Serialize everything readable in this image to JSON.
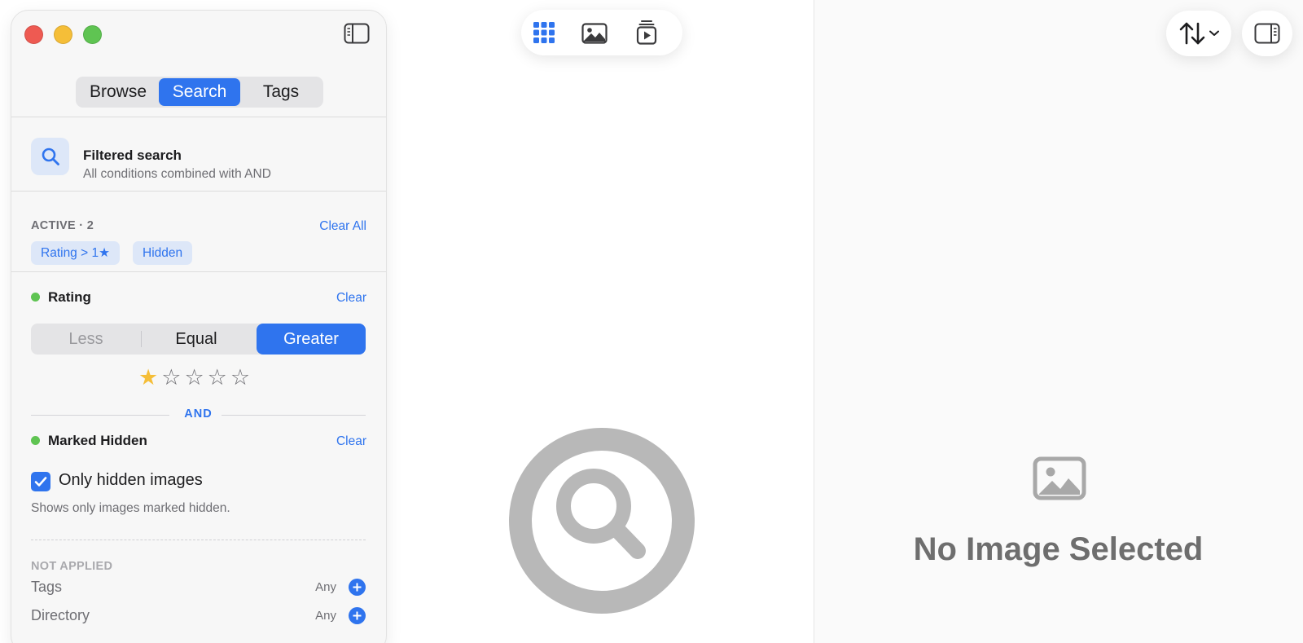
{
  "sidebar": {
    "tabs": [
      {
        "label": "Browse",
        "active": false
      },
      {
        "label": "Search",
        "active": true
      },
      {
        "label": "Tags",
        "active": false
      }
    ],
    "filtered_search": {
      "title": "Filtered search",
      "subtitle": "All conditions combined with AND"
    },
    "active": {
      "label": "ACTIVE · 2",
      "clear_all": "Clear All",
      "chips": [
        "Rating > 1★",
        "Hidden"
      ]
    },
    "rating": {
      "title": "Rating",
      "clear": "Clear",
      "comparisons": [
        "Less",
        "Equal",
        "Greater"
      ],
      "selected_comparison": "Greater",
      "value": 1,
      "max": 5
    },
    "and_label": "AND",
    "marked_hidden": {
      "title": "Marked Hidden",
      "clear": "Clear",
      "checkbox_label": "Only hidden images",
      "checked": true,
      "hint": "Shows only images marked hidden."
    },
    "not_applied": {
      "label": "NOT APPLIED",
      "items": [
        {
          "label": "Tags",
          "value": "Any"
        },
        {
          "label": "Directory",
          "value": "Any"
        }
      ]
    }
  },
  "toolbar": {
    "view_modes": [
      {
        "icon": "grid-icon",
        "active": true
      },
      {
        "icon": "photo-icon",
        "active": false
      },
      {
        "icon": "slideshow-icon",
        "active": false
      }
    ]
  },
  "detail": {
    "empty_text": "No Image Selected"
  },
  "colors": {
    "accent": "#2f74ee",
    "status_dot": "#5fc452",
    "star_filled": "#f5be38"
  }
}
